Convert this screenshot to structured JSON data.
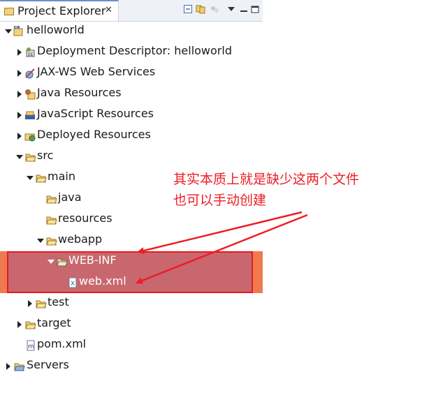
{
  "view": {
    "tab_title": "Project Explorer",
    "tab_close": "✕",
    "toolbar": [
      "collapse-all-icon",
      "link-with-editor-icon",
      "focus-icon",
      "view-menu-icon",
      "minimize-icon",
      "maximize-icon"
    ]
  },
  "tree": {
    "project": "helloworld",
    "deployment_descriptor": "Deployment Descriptor: helloworld",
    "jaxws": "JAX-WS Web Services",
    "java_resources": "Java Resources",
    "javascript_resources": "JavaScript Resources",
    "deployed_resources": "Deployed Resources",
    "src": "src",
    "main": "main",
    "java": "java",
    "resources": "resources",
    "webapp": "webapp",
    "webinf": "WEB-INF",
    "webxml": "web.xml",
    "test": "test",
    "target": "target",
    "pom": "pom.xml",
    "servers": "Servers"
  },
  "annotation": {
    "line1": "其实本质上就是缺少这两个文件",
    "line2": "也可以手动创建"
  },
  "colors": {
    "selection": "#f07a50",
    "highlight_fill": "#c8686e",
    "highlight_border": "#e8191e",
    "annotation": "#ee1c24"
  }
}
